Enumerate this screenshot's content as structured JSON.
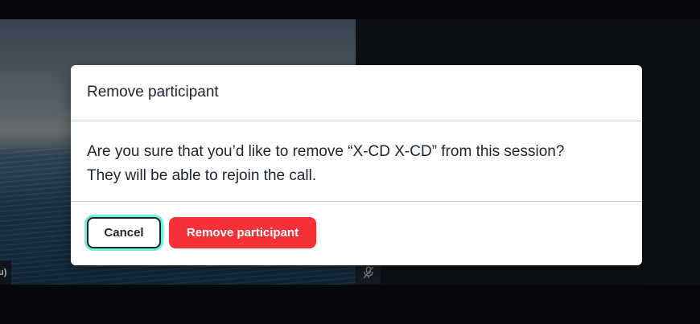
{
  "background": {
    "participant_name_fragment": "u)",
    "right_tile_icon": "mic-muted-icon"
  },
  "modal": {
    "title": "Remove participant",
    "message_line1": "Are you sure that you’d like to remove “X-CD X-CD” from this session?",
    "message_line2": "They will be able to rejoin the call.",
    "cancel_label": "Cancel",
    "confirm_label": "Remove participant"
  },
  "colors": {
    "accent_focus": "#72f0d2",
    "danger": "#f63138",
    "text": "#1b2631",
    "backdrop": "#0a0e13"
  }
}
